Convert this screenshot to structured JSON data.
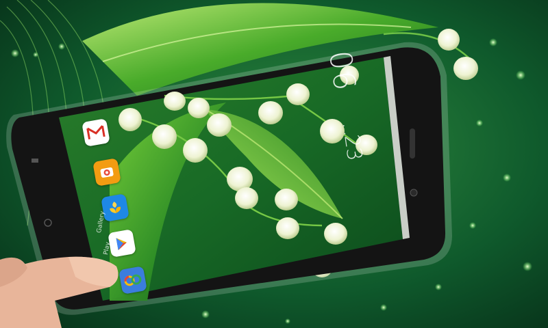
{
  "screen": {
    "clock": {
      "hour": "06",
      "separator": ":",
      "minute": "23"
    }
  },
  "dock_apps": [
    {
      "name": "Gmail",
      "icon": "gmail-icon",
      "color": "#ffffff"
    },
    {
      "name": "Camera",
      "icon": "camera-icon",
      "color": "#f39c12"
    },
    {
      "name": "Gallery",
      "icon": "gallery-icon",
      "color": "#1e88e5"
    },
    {
      "name": "Play Store",
      "icon": "play-store-icon",
      "color": "#ffffff"
    },
    {
      "name": "Photos",
      "icon": "photos-icon",
      "color": "#3b7ddd"
    }
  ],
  "dock_labels": [
    {
      "text": "Gallery"
    },
    {
      "text": "Play"
    }
  ],
  "colors": {
    "background": "#0b3a1e",
    "leaf": "#4caf2a",
    "phone_body": "#141414",
    "flower": "#f4f7e4"
  }
}
